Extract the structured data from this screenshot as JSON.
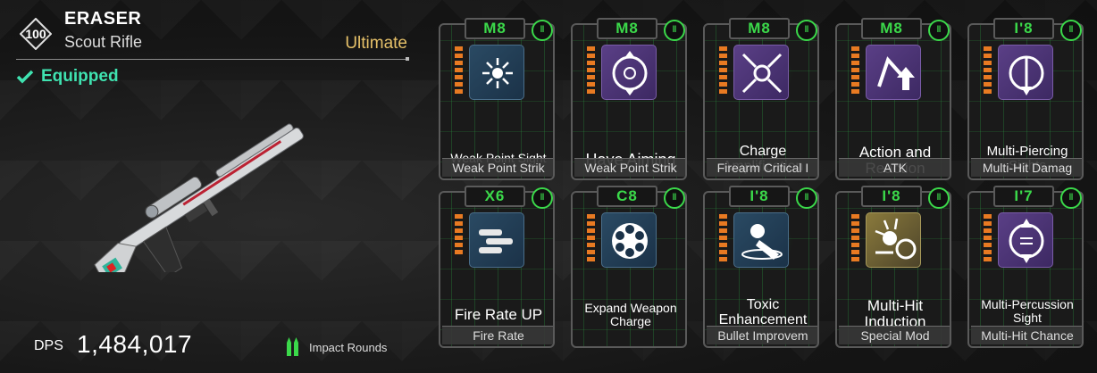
{
  "weapon": {
    "level": "100",
    "name": "ERASER",
    "type": "Scout Rifle",
    "rarity": "Ultimate",
    "equipped_label": "Equipped",
    "dps_label": "DPS",
    "dps_value": "1,484,017",
    "ammo_label": "Impact Rounds"
  },
  "colors": {
    "accent_green": "#3bd94a",
    "equipped_teal": "#3fe2b0",
    "rarity_gold": "#e6c169",
    "bar_orange": "#e87a22"
  },
  "modules": [
    {
      "grade": "M8",
      "title": "Weak Point Sight",
      "subtitle": "Weak Point Strik",
      "icon": "starburst-icon",
      "bg": "blue",
      "bars": 7
    },
    {
      "grade": "M8",
      "title": "Have Aiming",
      "subtitle": "Weak Point Strik",
      "icon": "crosshair-cycle-icon",
      "bg": "purple",
      "bars": 7
    },
    {
      "grade": "M8",
      "title": "Charge Amplification",
      "subtitle": "Firearm Critical I",
      "icon": "converge-arrows-icon",
      "bg": "purple",
      "bars": 7
    },
    {
      "grade": "M8",
      "title": "Action and Reaction",
      "subtitle": "ATK",
      "icon": "reaction-arrow-icon",
      "bg": "purple",
      "bars": 7
    },
    {
      "grade": "I'8",
      "title": "Multi-Piercing Sights",
      "subtitle": "Multi-Hit Damag",
      "icon": "pierce-cycle-icon",
      "bg": "purple",
      "bars": 7
    },
    {
      "grade": "X6",
      "title": "Fire Rate UP",
      "subtitle": "Fire Rate",
      "icon": "bullets-icon",
      "bg": "blue",
      "bars": 6
    },
    {
      "grade": "C8",
      "title": "Expand Weapon Charge",
      "subtitle": "",
      "icon": "revolver-cylinder-icon",
      "bg": "blue",
      "bars": 7
    },
    {
      "grade": "I'8",
      "title": "Toxic Enhancement",
      "subtitle": "Bullet Improvem",
      "icon": "toxic-skull-icon",
      "bg": "blue",
      "bars": 7
    },
    {
      "grade": "I'8",
      "title": "Multi-Hit Induction",
      "subtitle": "Special Mod",
      "icon": "multi-hit-explosion-icon",
      "bg": "gold",
      "bars": 7
    },
    {
      "grade": "I'7",
      "title": "Multi-Percussion Sight",
      "subtitle": "Multi-Hit Chance",
      "icon": "percussion-cycle-icon",
      "bg": "purple",
      "bars": 7
    }
  ]
}
